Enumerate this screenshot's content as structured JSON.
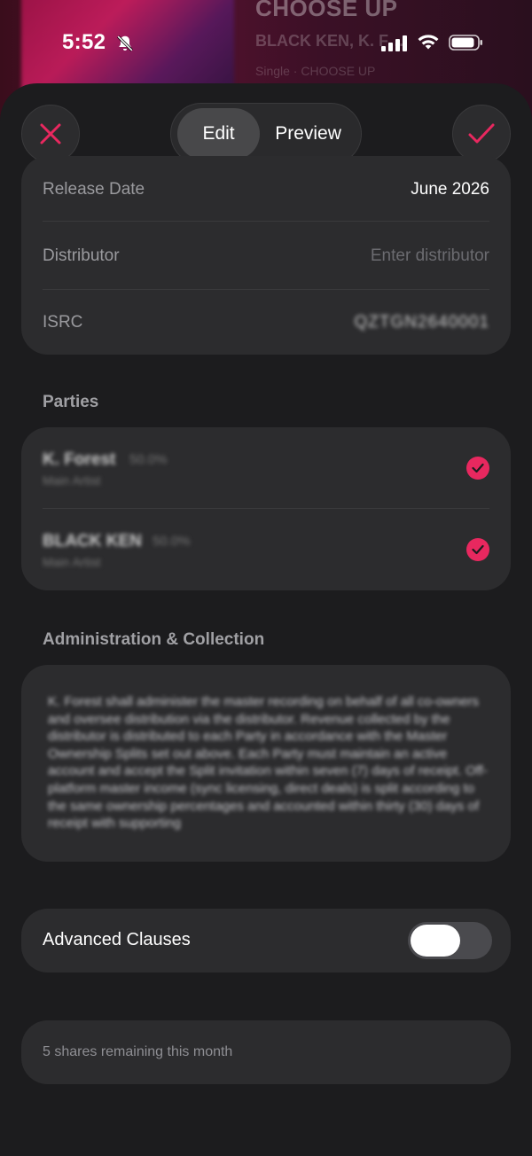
{
  "background": {
    "track_title": "CHOOSE UP",
    "track_artists": "BLACK KEN, K. F…",
    "track_meta": "Single · CHOOSE UP",
    "accent_color": "#e8285f"
  },
  "status_bar": {
    "time": "5:52",
    "icons": [
      "bell-slash-icon",
      "cellular-signal-icon",
      "wifi-icon",
      "battery-icon"
    ]
  },
  "header": {
    "close_icon": "x-icon",
    "done_icon": "checkmark-icon",
    "tabs": [
      {
        "label": "Edit",
        "active": true
      },
      {
        "label": "Preview",
        "active": false
      }
    ]
  },
  "details": {
    "release_date": {
      "label": "Release Date",
      "value": "June 2026"
    },
    "distributor": {
      "label": "Distributor",
      "placeholder": "Enter distributor"
    },
    "isrc": {
      "label": "ISRC",
      "value": "QZTGN2640001"
    }
  },
  "parties": {
    "title": "Parties",
    "items": [
      {
        "name": "K. Forest",
        "share": "50.0%",
        "role": "Main Artist",
        "checked": true
      },
      {
        "name": "BLACK KEN",
        "share": "50.0%",
        "role": "Main Artist",
        "checked": true
      }
    ]
  },
  "administration": {
    "title": "Administration & Collection",
    "text": "K. Forest shall administer the master recording on behalf of all co-owners and oversee distribution via the distributor. Revenue collected by the distributor is distributed to each Party in accordance with the Master Ownership Splits set out above. Each Party must maintain an active account and accept the Split invitation within seven (7) days of receipt. Off-platform master income (sync licensing, direct deals) is split according to the same ownership percentages and accounted within thirty (30) days of receipt with supporting"
  },
  "advanced": {
    "label": "Advanced Clauses",
    "enabled": false
  },
  "footer": {
    "shares_remaining": "5 shares remaining this month"
  }
}
